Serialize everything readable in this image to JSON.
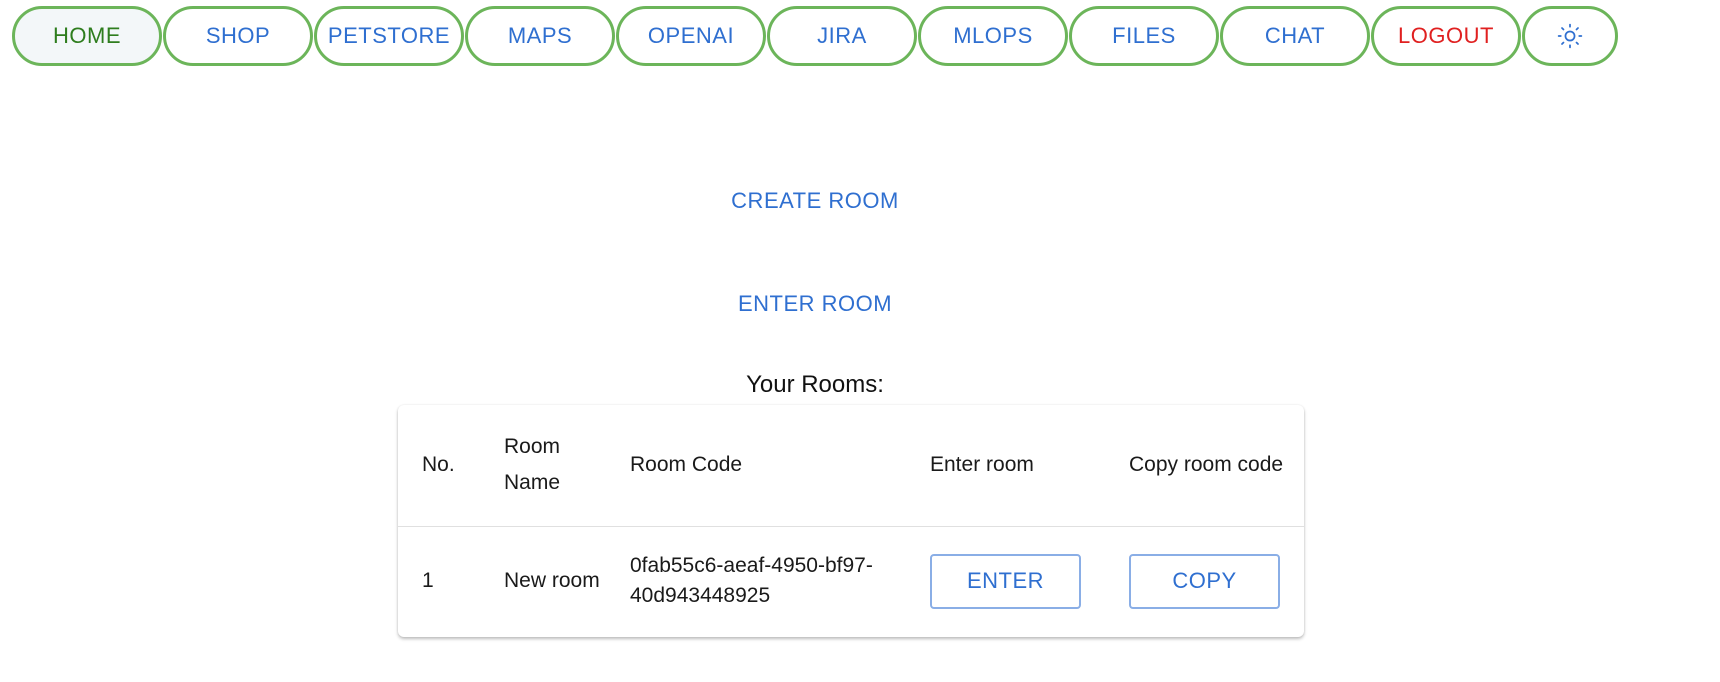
{
  "nav": {
    "home": "HOME",
    "shop": "SHOP",
    "petstore": "PETSTORE",
    "maps": "MAPS",
    "openai": "OPENAI",
    "jira": "JIRA",
    "mlops": "MLOPS",
    "files": "FILES",
    "chat": "CHAT",
    "logout": "LOGOUT",
    "theme_icon": "sun-icon"
  },
  "actions": {
    "create_room": "CREATE ROOM",
    "enter_room": "ENTER ROOM"
  },
  "rooms": {
    "title": "Your Rooms:",
    "columns": {
      "no": "No.",
      "room_name": "Room Name",
      "room_code": "Room Code",
      "enter_room": "Enter room",
      "copy_room_code": "Copy room code"
    },
    "rows": [
      {
        "no": "1",
        "room_name": "New room",
        "room_code": "0fab55c6-aeaf-4950-bf97-40d943448925",
        "enter_label": "ENTER",
        "copy_label": "COPY"
      }
    ]
  },
  "colors": {
    "nav_border": "#6cb55a",
    "link_blue": "#2f6fd0",
    "active_green": "#2e7d1e",
    "logout_red": "#e02020"
  }
}
